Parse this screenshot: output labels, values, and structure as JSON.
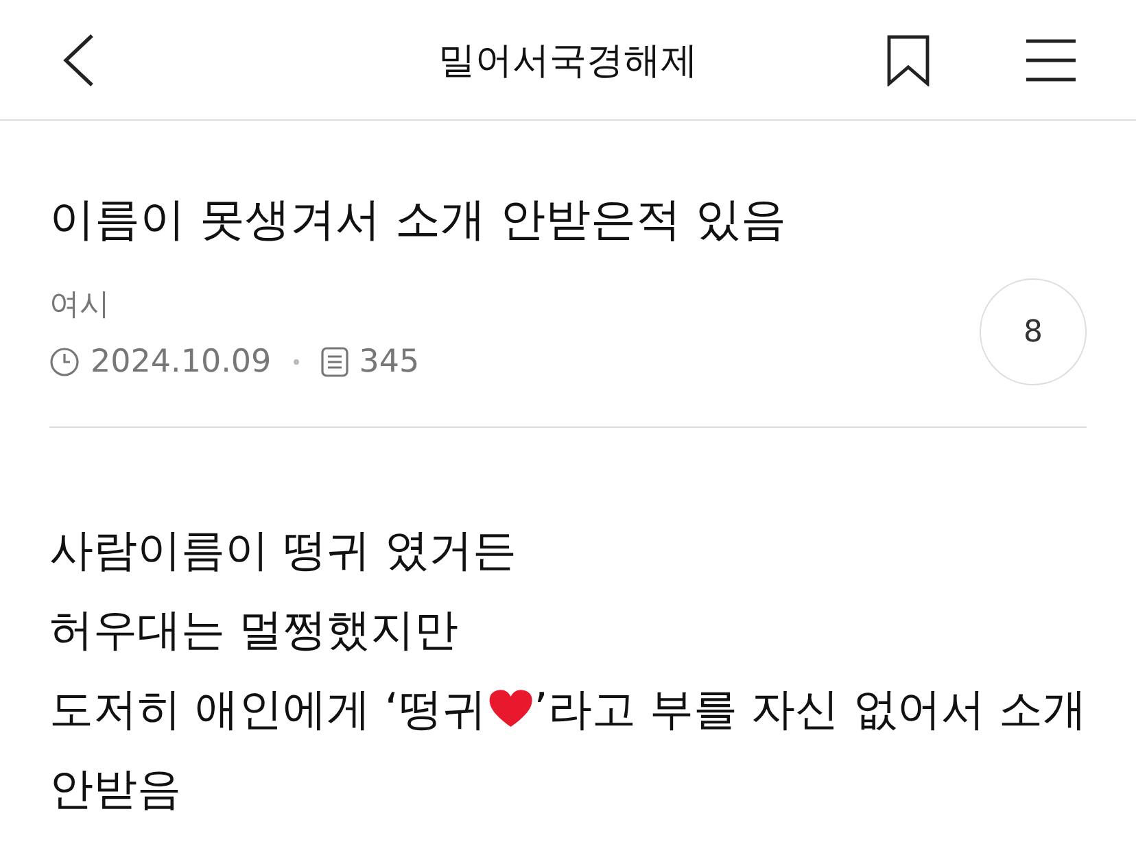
{
  "header": {
    "title": "밀어서국경해제"
  },
  "post": {
    "title": "이름이 못생겨서 소개 안받은적 있음",
    "author": "여시",
    "date": "2024.10.09",
    "views": "345",
    "comments": "8"
  },
  "body": [
    [
      {
        "kind": "text",
        "text": "사람이름이 떵귀 였거든"
      }
    ],
    [
      {
        "kind": "text",
        "text": "허우대는 멀쩡했지만"
      }
    ],
    [
      {
        "kind": "text",
        "text": "도저히 애인에게 ‘떵귀"
      },
      {
        "kind": "heart"
      },
      {
        "kind": "text",
        "text": "’라고 부를 자신 없어서 소개"
      }
    ],
    [
      {
        "kind": "text",
        "text": "안받음"
      }
    ]
  ]
}
